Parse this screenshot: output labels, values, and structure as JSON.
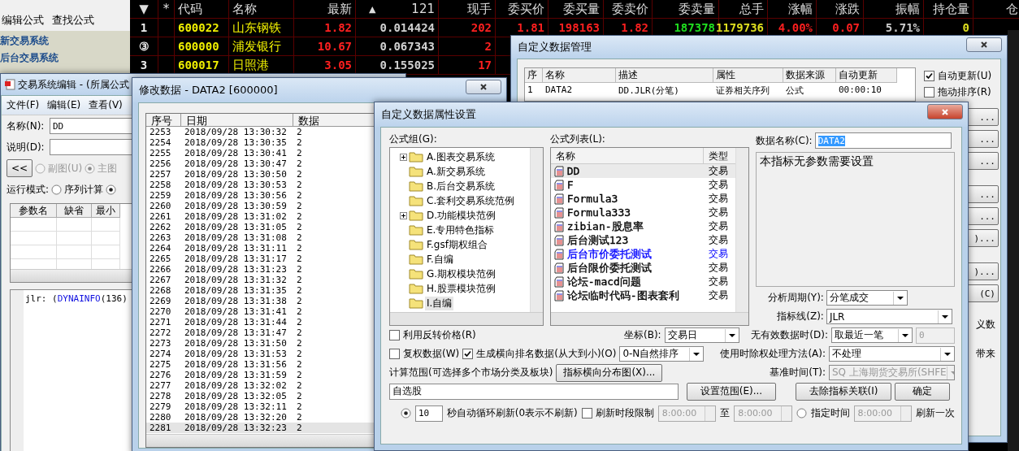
{
  "left_panel": {
    "menu": [
      "编辑公式",
      "查找公式"
    ],
    "items": [
      "新交易系统",
      "后台交易系统"
    ]
  },
  "quote_table": {
    "columns": [
      {
        "label": "▼"
      },
      {
        "label": "*"
      },
      {
        "label": "代码"
      },
      {
        "label": "名称"
      },
      {
        "label": "最新"
      },
      {
        "marker": "▲",
        "label": "121"
      },
      {
        "label": "现手"
      },
      {
        "label": "委买价"
      },
      {
        "label": "委买量"
      },
      {
        "label": "委卖价"
      },
      {
        "label": "委卖量"
      },
      {
        "label": "总手"
      },
      {
        "label": "涨幅"
      },
      {
        "label": "涨跌"
      },
      {
        "label": "振幅"
      },
      {
        "label": "持仓量"
      },
      {
        "label": "仓"
      }
    ],
    "rows": [
      {
        "no": "1",
        "code": "600022",
        "name": "山东钢铁",
        "values": [
          {
            "text": "1.82",
            "color": "#ff2020"
          },
          {
            "text": "0.014424",
            "color": "#d0d0d0"
          },
          {
            "text": "202",
            "color": "#ff2020"
          },
          {
            "text": "1.81",
            "color": "#ff2020"
          },
          {
            "text": "198163",
            "color": "#ff2020"
          },
          {
            "text": "1.82",
            "color": "#ff2020"
          },
          {
            "text": "187378",
            "color": "#20e020"
          },
          {
            "text": "1179736",
            "color": "#e0e020"
          },
          {
            "text": "4.00%",
            "color": "#ff2020"
          },
          {
            "text": "0.07",
            "color": "#ff2020"
          },
          {
            "text": "5.71%",
            "color": "#d0d0d0"
          },
          {
            "text": "0",
            "color": "#e0e020"
          }
        ]
      },
      {
        "no": "③",
        "code": "600000",
        "name": "浦发银行",
        "values": [
          {
            "text": "10.67",
            "color": "#ff2020"
          },
          {
            "text": "0.067343",
            "color": "#d0d0d0"
          },
          {
            "text": "2",
            "color": "#ff2020"
          }
        ]
      },
      {
        "no": "3",
        "code": "600017",
        "name": "日照港",
        "values": [
          {
            "text": "3.05",
            "color": "#ff2020"
          },
          {
            "text": "0.155025",
            "color": "#d0d0d0"
          },
          {
            "text": "17",
            "color": "#ff2020"
          }
        ]
      }
    ]
  },
  "formula_editor": {
    "title": "交易系统编辑 - (所属公式",
    "menu": [
      "文件(F)",
      "编辑(E)",
      "查看(V)"
    ],
    "name_label": "名称(N):",
    "name_value": "DD",
    "desc_label": "说明(D):",
    "back_button": "<<",
    "chart_options": [
      {
        "label": "副图(U)",
        "selected": false
      },
      {
        "label": "主图",
        "selected": true
      }
    ],
    "run_mode_label": "运行模式:",
    "run_modes": [
      {
        "label": "序列计算",
        "selected": false
      },
      {
        "selected": true
      }
    ],
    "param_columns": [
      "参数名",
      "缺省",
      "最小"
    ],
    "code": [
      {
        "text": "jlr: (",
        "kind": "plain"
      },
      {
        "text": "DYNAINFO",
        "kind": "function"
      },
      {
        "text": "(136)",
        "kind": "plain"
      }
    ]
  },
  "modify_data": {
    "title": "修改数据 - DATA2 [600000]",
    "columns": [
      "序号",
      "日期",
      "数据"
    ],
    "rows": [
      {
        "no": "2253",
        "date": "2018/09/28 13:30:32",
        "value": "2",
        "selected": false
      },
      {
        "no": "2254",
        "date": "2018/09/28 13:30:35",
        "value": "2",
        "selected": false
      },
      {
        "no": "2255",
        "date": "2018/09/28 13:30:41",
        "value": "2",
        "selected": false
      },
      {
        "no": "2256",
        "date": "2018/09/28 13:30:47",
        "value": "2",
        "selected": false
      },
      {
        "no": "2257",
        "date": "2018/09/28 13:30:50",
        "value": "2",
        "selected": false
      },
      {
        "no": "2258",
        "date": "2018/09/28 13:30:53",
        "value": "2",
        "selected": false
      },
      {
        "no": "2259",
        "date": "2018/09/28 13:30:56",
        "value": "2",
        "selected": false
      },
      {
        "no": "2260",
        "date": "2018/09/28 13:30:59",
        "value": "2",
        "selected": false
      },
      {
        "no": "2261",
        "date": "2018/09/28 13:31:02",
        "value": "2",
        "selected": false
      },
      {
        "no": "2262",
        "date": "2018/09/28 13:31:05",
        "value": "2",
        "selected": false
      },
      {
        "no": "2263",
        "date": "2018/09/28 13:31:08",
        "value": "2",
        "selected": false
      },
      {
        "no": "2264",
        "date": "2018/09/28 13:31:11",
        "value": "2",
        "selected": false
      },
      {
        "no": "2265",
        "date": "2018/09/28 13:31:17",
        "value": "2",
        "selected": false
      },
      {
        "no": "2266",
        "date": "2018/09/28 13:31:23",
        "value": "2",
        "selected": false
      },
      {
        "no": "2267",
        "date": "2018/09/28 13:31:32",
        "value": "2",
        "selected": false
      },
      {
        "no": "2268",
        "date": "2018/09/28 13:31:35",
        "value": "2",
        "selected": false
      },
      {
        "no": "2269",
        "date": "2018/09/28 13:31:38",
        "value": "2",
        "selected": false
      },
      {
        "no": "2270",
        "date": "2018/09/28 13:31:41",
        "value": "2",
        "selected": false
      },
      {
        "no": "2271",
        "date": "2018/09/28 13:31:44",
        "value": "2",
        "selected": false
      },
      {
        "no": "2272",
        "date": "2018/09/28 13:31:47",
        "value": "2",
        "selected": false
      },
      {
        "no": "2273",
        "date": "2018/09/28 13:31:50",
        "value": "2",
        "selected": false
      },
      {
        "no": "2274",
        "date": "2018/09/28 13:31:53",
        "value": "2",
        "selected": false
      },
      {
        "no": "2275",
        "date": "2018/09/28 13:31:56",
        "value": "2",
        "selected": false
      },
      {
        "no": "2276",
        "date": "2018/09/28 13:31:59",
        "value": "2",
        "selected": false
      },
      {
        "no": "2277",
        "date": "2018/09/28 13:32:02",
        "value": "2",
        "selected": false
      },
      {
        "no": "2278",
        "date": "2018/09/28 13:32:05",
        "value": "2",
        "selected": false
      },
      {
        "no": "2279",
        "date": "2018/09/28 13:32:11",
        "value": "2",
        "selected": false
      },
      {
        "no": "2280",
        "date": "2018/09/28 13:32:20",
        "value": "2",
        "selected": false
      },
      {
        "no": "2281",
        "date": "2018/09/28 13:32:23",
        "value": "2",
        "selected": true
      }
    ]
  },
  "data_manager": {
    "title": "自定义数据管理",
    "columns": [
      "序",
      "名称",
      "描述",
      "属性",
      "数据来源",
      "自动更新"
    ],
    "rows": [
      {
        "cells": [
          "1",
          "DATA2",
          "DD.JLR(分笔)",
          "证券相关序列",
          "公式",
          "00:00:10"
        ]
      }
    ],
    "options": [
      {
        "label": "自动更新(U)",
        "checked": true
      },
      {
        "label": "拖动排序(R)",
        "checked": false
      }
    ],
    "buttons": [
      "...",
      "...",
      "...",
      "...",
      "...",
      ")...",
      ")...",
      "(C)"
    ],
    "side_texts": [
      "义数",
      "带来"
    ]
  },
  "property_dialog": {
    "title": "自定义数据属性设置",
    "group_label": "公式组(G):",
    "groups": [
      {
        "label": "A.图表交易系统",
        "expandable": true,
        "selected": false
      },
      {
        "label": "A.新交易系统",
        "expandable": false,
        "selected": false
      },
      {
        "label": "B.后台交易系统",
        "expandable": false,
        "selected": false
      },
      {
        "label": "C.套利交易系统范例",
        "expandable": false,
        "selected": false
      },
      {
        "label": "D.功能模块范例",
        "expandable": true,
        "selected": false
      },
      {
        "label": "E.专用特色指标",
        "expandable": false,
        "selected": false
      },
      {
        "label": "F.gsf期权组合",
        "expandable": false,
        "selected": false
      },
      {
        "label": "F.自编",
        "expandable": false,
        "selected": false
      },
      {
        "label": "G.期权模块范例",
        "expandable": false,
        "selected": false
      },
      {
        "label": "H.股票模块范例",
        "expandable": false,
        "selected": false
      },
      {
        "label": "I.自编",
        "expandable": false,
        "selected": true
      }
    ],
    "list_label": "公式列表(L):",
    "list_columns": [
      "名称",
      "类型"
    ],
    "formulas": [
      {
        "name": "DD",
        "type": "交易",
        "color": "#000000",
        "selected": true
      },
      {
        "name": "F",
        "type": "交易",
        "color": "#000000",
        "selected": false
      },
      {
        "name": "Formula3",
        "type": "交易",
        "color": "#000000",
        "selected": false
      },
      {
        "name": "Formula333",
        "type": "交易",
        "color": "#000000",
        "selected": false
      },
      {
        "name": "zibian-股息率",
        "type": "交易",
        "color": "#000000",
        "selected": false
      },
      {
        "name": "后台测试123",
        "type": "交易",
        "color": "#000000",
        "selected": false
      },
      {
        "name": "后台市价委托测试",
        "type": "交易",
        "color": "#0000ff",
        "selected": false
      },
      {
        "name": "后台限价委托测试",
        "type": "交易",
        "color": "#000000",
        "selected": false
      },
      {
        "name": "论坛-macd问题",
        "type": "交易",
        "color": "#000000",
        "selected": false
      },
      {
        "name": "论坛临时代码-图表套利",
        "type": "交易",
        "color": "#000000",
        "selected": false
      }
    ],
    "data_name_label": "数据名称(C):",
    "data_name": "DATA2",
    "description": "本指标无参数需要设置",
    "period": {
      "label": "分析周期(Y):",
      "value": "分笔成交"
    },
    "line": {
      "label": "指标线(Z):",
      "value": "JLR"
    },
    "reverse": {
      "label": "利用反转价格(R)",
      "checked": false
    },
    "axis": {
      "label": "坐标(B):",
      "value": "交易日"
    },
    "no_data": {
      "label": "无有效数据时(D):",
      "value": "取最近一笔",
      "extra": "0"
    },
    "adjusted": {
      "label": "复权数据(W)",
      "checked": false
    },
    "ranking": {
      "label": "生成横向排名数据(从大到小)(O)",
      "checked": true,
      "value": "0-N自然排序"
    },
    "exright": {
      "label": "使用时除权处理方法(A):",
      "value": "不处理"
    },
    "range_label": "计算范围(可选择多个市场分类及板块)",
    "distribution_button": "指标横向分布图(X)...",
    "base_time": {
      "label": "基准时间(T):",
      "value": "SQ 上海期货交易所(SHFE",
      "disabled": true
    },
    "range_value": "自选股",
    "buttons": [
      "设置范围(E)...",
      "去除指标关联(I)",
      "确定"
    ],
    "refresh": {
      "auto": {
        "selected": true,
        "value": "10",
        "label": "秒自动循环刷新(0表示不刷新)"
      },
      "period_limit": {
        "label": "刷新时段限制",
        "checked": false,
        "from": "8:00:00",
        "to_label": "至",
        "to": "8:00:00"
      },
      "fixed": {
        "selected": false,
        "label": "指定时间",
        "time": "8:00:00",
        "suffix": "刷新一次"
      }
    }
  }
}
